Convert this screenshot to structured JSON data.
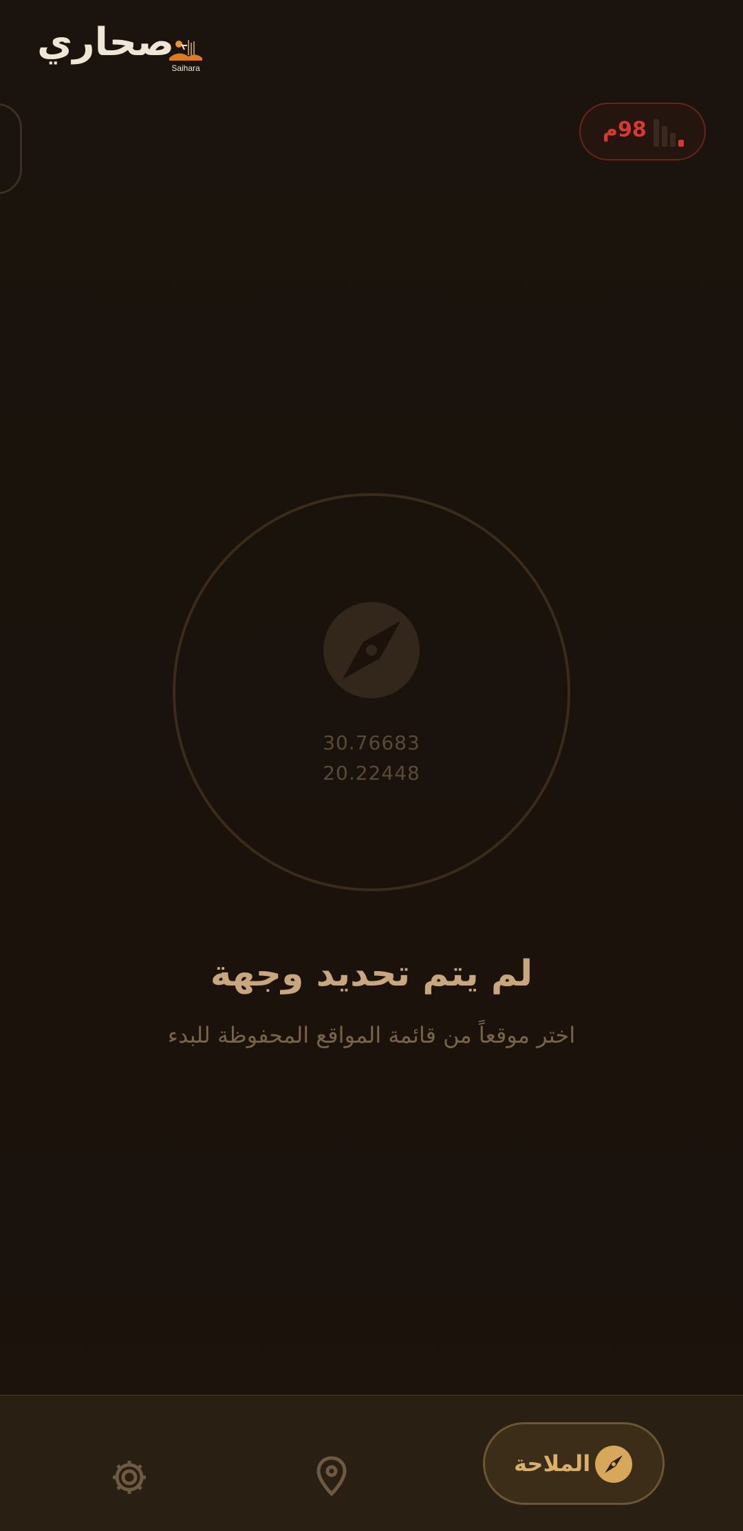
{
  "header": {
    "app_title": "صحاري",
    "logo_caption": "Saihara"
  },
  "signal": {
    "value": "98م",
    "level_bars_active": 1,
    "level_bars_total": 4,
    "status_color": "#d9382e"
  },
  "compass": {
    "latitude": "30.76683",
    "longitude": "20.22448",
    "icon": "compass-icon"
  },
  "message": {
    "title": "لم يتم تحديد وجهة",
    "subtitle": "اختر موقعاً من قائمة المواقع المحفوظة للبدء"
  },
  "bottom_nav": {
    "items": [
      {
        "icon": "gear-icon",
        "label": ""
      },
      {
        "icon": "location-pin-icon",
        "label": ""
      },
      {
        "icon": "compass-icon",
        "label": "الملاحة",
        "active": true
      }
    ]
  },
  "colors": {
    "background": "#1a120b",
    "accent": "#d8a85a",
    "text_primary": "#efe6d6",
    "text_muted": "#7a6448"
  }
}
